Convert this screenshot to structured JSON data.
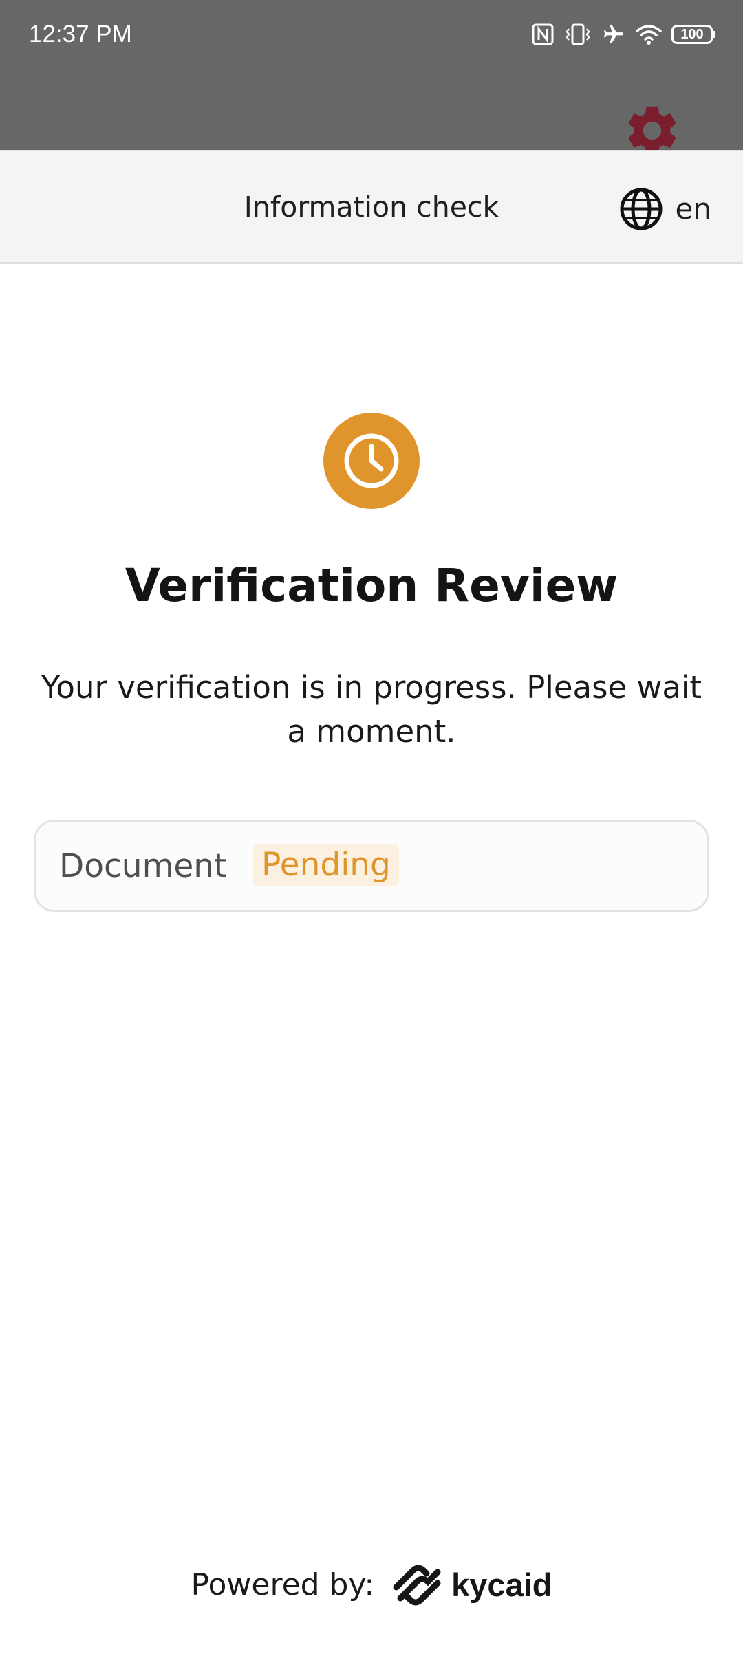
{
  "status_bar": {
    "time": "12:37 PM",
    "battery": "100",
    "icons": [
      "nfc-icon",
      "vibrate-icon",
      "airplane-mode-icon",
      "wifi-icon",
      "battery-icon"
    ]
  },
  "header": {
    "title": "Information check",
    "language": "en",
    "language_icon": "globe-icon",
    "settings_icon": "gear-icon"
  },
  "main": {
    "status_icon": "clock-icon",
    "title": "Verification Review",
    "description": "Your verification is in progress. Please wait a moment.",
    "items": [
      {
        "label": "Document",
        "status": "Pending"
      }
    ]
  },
  "footer": {
    "powered_label": "Powered by:",
    "brand": "kycaid"
  },
  "colors": {
    "status_bar_bg": "#676767",
    "header_bg": "#f4f4f4",
    "accent_pending": "#e0952c",
    "pending_badge_bg": "#fcf1e1",
    "gear": "#7a1e2e"
  }
}
